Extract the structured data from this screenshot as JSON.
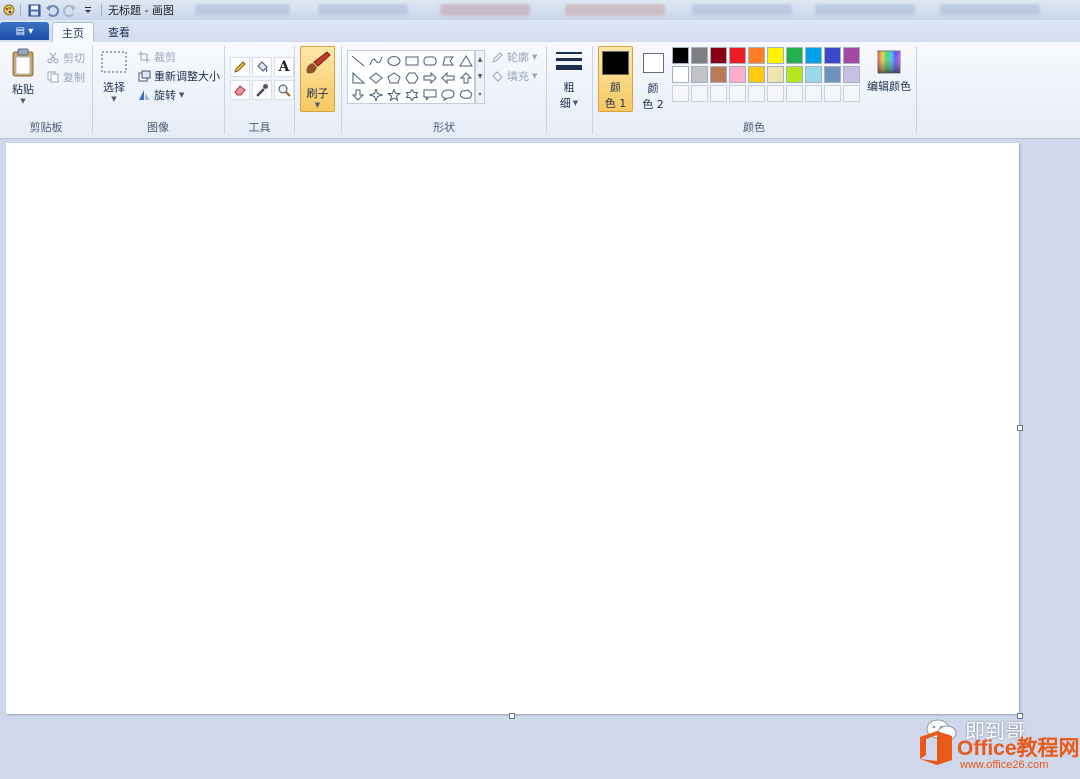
{
  "window": {
    "title": "无标题 - 画图"
  },
  "menu": {
    "file_label": "▤ ▾",
    "tabs": [
      {
        "label": "主页",
        "active": true
      },
      {
        "label": "查看",
        "active": false
      }
    ]
  },
  "ribbon": {
    "clipboard": {
      "group_label": "剪贴板",
      "paste_label": "粘贴",
      "cut_label": "剪切",
      "copy_label": "复制"
    },
    "image": {
      "group_label": "图像",
      "select_label": "选择",
      "crop_label": "裁剪",
      "resize_label": "重新调整大小",
      "rotate_label": "旋转"
    },
    "tools": {
      "group_label": "工具",
      "text_tool_glyph": "A"
    },
    "brushes": {
      "label": "刷子"
    },
    "shapes": {
      "group_label": "形状",
      "outline_label": "轮廓",
      "fill_label": "填充"
    },
    "size": {
      "label_line1": "粗",
      "label_line2": "细"
    },
    "colors": {
      "group_label": "颜色",
      "color1_line1": "颜",
      "color1_line2": "色 1",
      "color2_line1": "颜",
      "color2_line2": "色 2",
      "edit_colors_label": "编辑颜色",
      "color1": "#000000",
      "color2": "#ffffff",
      "palette_row1": [
        "#000000",
        "#7f7f7f",
        "#880015",
        "#ed1c24",
        "#ff7f27",
        "#fff200",
        "#22b14c",
        "#00a2e8",
        "#3f48cc",
        "#a349a4"
      ],
      "palette_row2": [
        "#ffffff",
        "#c3c3c3",
        "#b97a57",
        "#ffaec9",
        "#ffc90e",
        "#efe4b0",
        "#b5e61d",
        "#99d9ea",
        "#7092be",
        "#c8bfe7"
      ]
    }
  },
  "watermark": {
    "author": "即到哥",
    "brand": "Office教程网",
    "url": "www.office26.com"
  }
}
